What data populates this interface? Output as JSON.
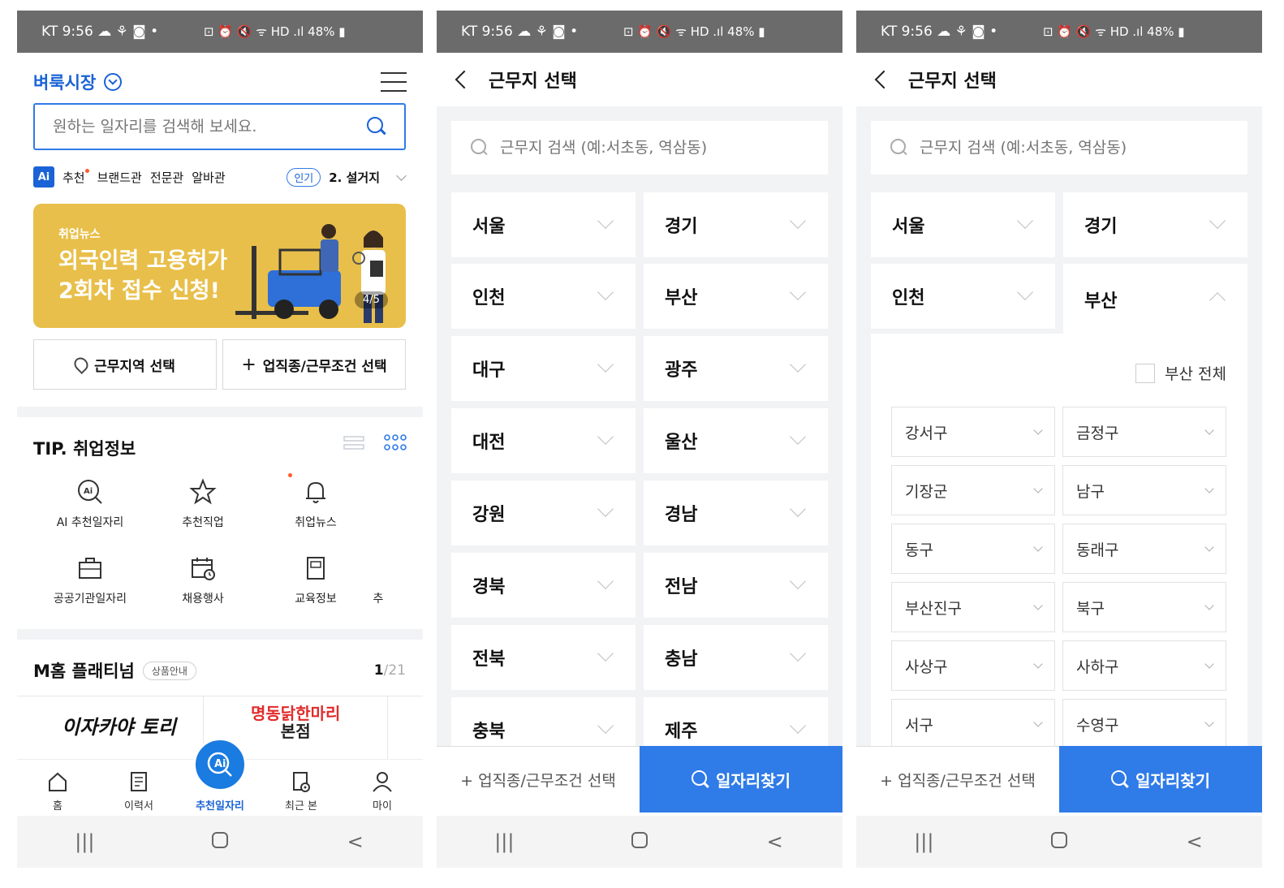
{
  "status_bar": {
    "left": "KT 9:56 ☁ ⚘ ◙ •",
    "right": "⊡ ⏰ 🔇 ᯤ HD .ıl 48% ▮"
  },
  "nav_keys": {
    "recent": "|||",
    "back": "<"
  },
  "screen1": {
    "title": "벼룩시장",
    "search_placeholder": "원하는 일자리를 검색해 보세요.",
    "tabs": [
      "추천",
      "브랜드관",
      "전문관",
      "알바관"
    ],
    "ai_badge": "Ai",
    "popular_badge": "인기",
    "popular_keyword": "2. 설거지",
    "banner": {
      "tag": "취업뉴스",
      "headline_1": "외국인력 고용허가",
      "headline_2": "2회차 접수 신청!",
      "page": "4/5"
    },
    "select_region": "근무지역 선택",
    "select_job": "업직종/근무조건 선택",
    "tip_title": "TIP. 취업정보",
    "grid_items": [
      "AI 추천일자리",
      "추천직업",
      "취업뉴스",
      "공공기관일자리",
      "채용행사",
      "교육정보",
      "추"
    ],
    "mhome_title": "M홈 플래티넘",
    "mhome_badge": "상품안내",
    "counter_current": "1",
    "counter_total": "/21",
    "logo1": "이자카야 토리",
    "logo2_line1": "명동닭한마리",
    "logo2_line2": "본점",
    "bottom_nav": [
      "홈",
      "이력서",
      "추천일자리",
      "최근 본",
      "마이"
    ],
    "fab_label": "Ai"
  },
  "location": {
    "title": "근무지 선택",
    "search_placeholder": "근무지 검색 (예:서초동, 역삼동)",
    "regions": [
      "서울",
      "경기",
      "인천",
      "부산",
      "대구",
      "광주",
      "대전",
      "울산",
      "강원",
      "경남",
      "경북",
      "전남",
      "전북",
      "충남",
      "충북",
      "제주"
    ],
    "footer_left": "+ 업직종/근무조건 선택",
    "footer_right": "일자리찾기"
  },
  "screen3": {
    "all_label": "부산 전체",
    "districts": [
      "강서구",
      "금정구",
      "기장군",
      "남구",
      "동구",
      "동래구",
      "부산진구",
      "북구",
      "사상구",
      "사하구",
      "서구",
      "수영구"
    ]
  }
}
